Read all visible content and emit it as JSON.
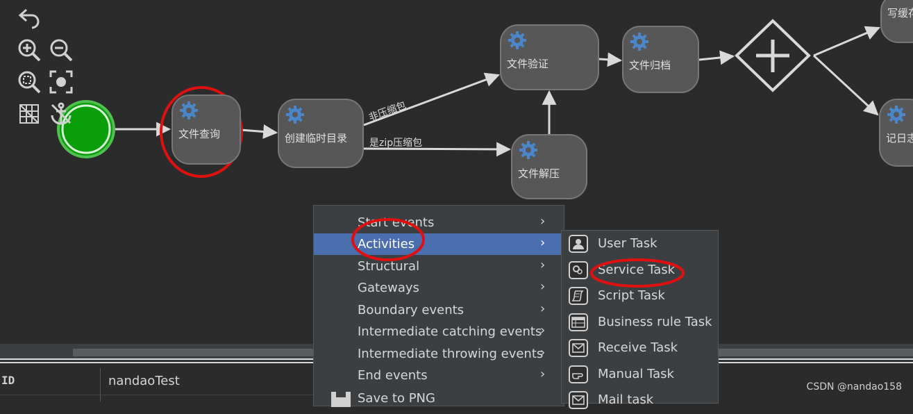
{
  "diagram": {
    "tasks": [
      {
        "id": "t1",
        "label": "文件查询"
      },
      {
        "id": "t2",
        "label": "创建临时目录"
      },
      {
        "id": "t3",
        "label": "文件验证"
      },
      {
        "id": "t4",
        "label": "文件归档"
      },
      {
        "id": "t5",
        "label": "文件解压"
      },
      {
        "id": "t6",
        "label": "写缓存"
      },
      {
        "id": "t7",
        "label": "记日志"
      }
    ],
    "edge_labels": {
      "non_zip": "非压缩包",
      "zip": "是zip压缩包"
    }
  },
  "context_menu": {
    "items": [
      {
        "label": "Start events"
      },
      {
        "label": "Activities"
      },
      {
        "label": "Structural"
      },
      {
        "label": "Gateways"
      },
      {
        "label": "Boundary events"
      },
      {
        "label": "Intermediate catching events"
      },
      {
        "label": "Intermediate throwing events"
      },
      {
        "label": "End events"
      },
      {
        "label": "Save to PNG"
      }
    ],
    "active_item": "Activities"
  },
  "submenu": {
    "items": [
      {
        "label": "User Task",
        "icon": "user-icon"
      },
      {
        "label": "Service Task",
        "icon": "gear-icon"
      },
      {
        "label": "Script Task",
        "icon": "script-icon"
      },
      {
        "label": "Business rule Task",
        "icon": "table-icon"
      },
      {
        "label": "Receive Task",
        "icon": "envelope-icon"
      },
      {
        "label": "Manual Task",
        "icon": "hand-icon"
      },
      {
        "label": "Mail task",
        "icon": "envelope-icon"
      }
    ]
  },
  "properties": {
    "id_key": "ID",
    "id_value": "nandaoTest"
  },
  "watermark": "CSDN @nandao158",
  "colors": {
    "background": "#2b2b2b",
    "task_fill": "#575757",
    "start_event": "#0a9e0a",
    "highlight_circle": "#e01010",
    "menu_active": "#4b6eaf",
    "gear": "#4a86c8"
  }
}
